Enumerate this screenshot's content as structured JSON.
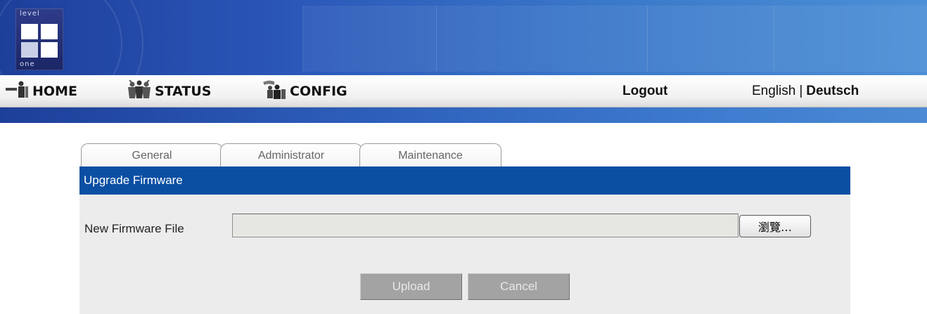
{
  "nav": {
    "home_label": "HOME",
    "status_label": "STATUS",
    "config_label": "CONFIG",
    "logout_label": "Logout",
    "lang_english": "English",
    "lang_separator": "|",
    "lang_deutsch": "Deutsch"
  },
  "tabs": [
    {
      "label": "General"
    },
    {
      "label": "Administrator"
    },
    {
      "label": "Maintenance"
    }
  ],
  "section": {
    "title": "Upgrade Firmware"
  },
  "form": {
    "file_label": "New Firmware File",
    "file_value": "",
    "browse_label": "瀏覽…",
    "upload_label": "Upload",
    "cancel_label": "Cancel"
  },
  "colors": {
    "banner_blue": "#2a56b8",
    "section_bar": "#0b4fa3",
    "button_gray": "#a3a3a3"
  },
  "icons": {
    "home": "home-person-icon",
    "status": "status-people-icon",
    "config": "config-people-icon"
  }
}
